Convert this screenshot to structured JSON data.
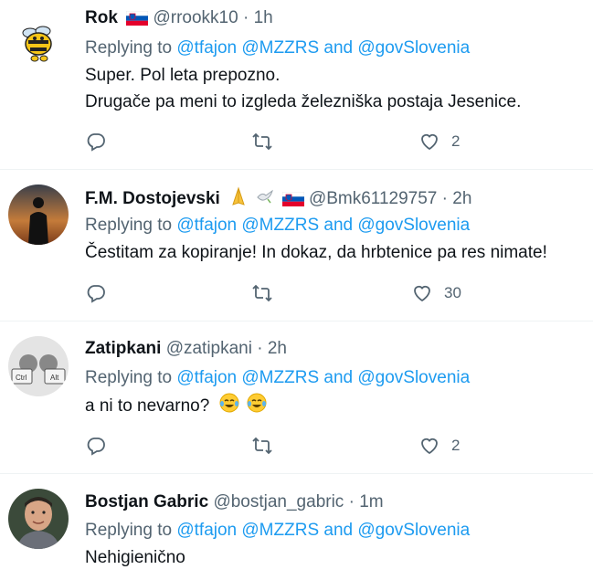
{
  "tweets": [
    {
      "name": "Rok",
      "handle": "@rrookk10",
      "dot": "·",
      "time": "1h",
      "reply_prefix": "Replying to",
      "mentions": "@tfajon @MZZRS and @govSlovenia",
      "lines": [
        "Super. Pol leta prepozno.",
        "Drugače pa meni to izgleda železniška postaja Jesenice."
      ],
      "replies": "",
      "retweets": "",
      "likes": "2",
      "name_emoji": [
        "flag-slovenia-icon"
      ]
    },
    {
      "name": "F.M. Dostojevski",
      "handle": "@Bmk61129757",
      "dot": "·",
      "time": "2h",
      "reply_prefix": "Replying to",
      "mentions": "@tfajon @MZZRS and @govSlovenia",
      "lines": [
        "Čestitam za kopiranje! In dokaz, da hrbtenice pa res nimate!"
      ],
      "replies": "",
      "retweets": "",
      "likes": "30",
      "name_emoji": [
        "folded-hands-icon",
        "dove-icon",
        "flag-slovenia-icon"
      ]
    },
    {
      "name": "Zatipkani",
      "handle": "@zatipkani",
      "dot": "·",
      "time": "2h",
      "reply_prefix": "Replying to",
      "mentions": "@tfajon @MZZRS and @govSlovenia",
      "lines": [
        "a ni to nevarno?"
      ],
      "replies": "",
      "retweets": "",
      "likes": "2",
      "body_emoji": [
        "tears-of-joy-icon",
        "tears-of-joy-icon"
      ]
    },
    {
      "name": "Bostjan Gabric",
      "handle": "@bostjan_gabric",
      "dot": "·",
      "time": "1m",
      "reply_prefix": "Replying to",
      "mentions": "@tfajon @MZZRS and @govSlovenia",
      "lines": [
        "Nehigienično"
      ]
    }
  ],
  "colors": {
    "link": "#1d9bf0",
    "secondary": "#536471",
    "text": "#0f1419",
    "divider": "#eff3f4"
  }
}
